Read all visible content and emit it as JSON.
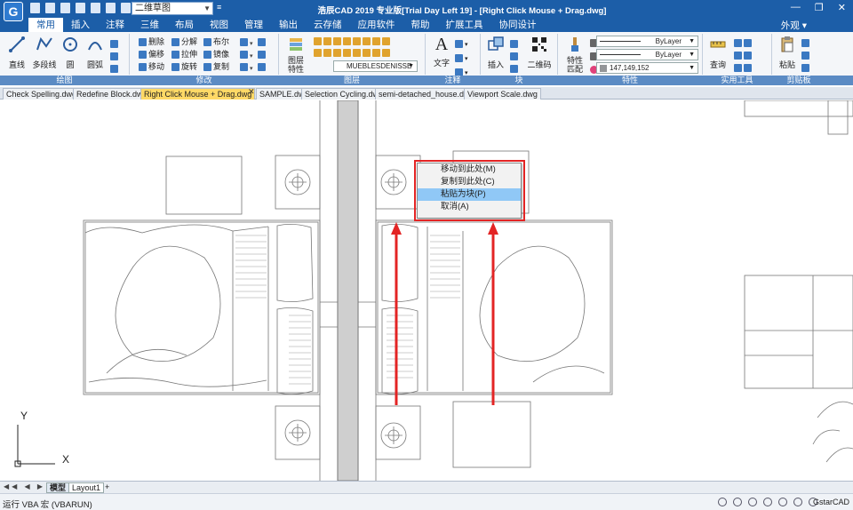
{
  "app": {
    "title": "浩辰CAD 2019 专业版[Trial Day Left 19] - [Right Click Mouse + Drag.dwg]",
    "workspace": "二维草图",
    "window_controls": [
      "—",
      "❐",
      "✕"
    ]
  },
  "menu": {
    "tabs": [
      "常用",
      "插入",
      "注释",
      "三维",
      "布局",
      "视图",
      "管理",
      "输出",
      "云存储",
      "应用软件",
      "帮助",
      "扩展工具",
      "协同设计"
    ],
    "active": "常用",
    "right": "外观 ▾"
  },
  "ribbon": {
    "panels": [
      "绘图",
      "修改",
      "图层",
      "注释",
      "块",
      "特性",
      "实用工具",
      "剪贴板"
    ],
    "draw": {
      "line": "直线",
      "polyline": "多段线",
      "circle": "圆",
      "arc": "圆弧"
    },
    "modify": {
      "erase": "删除",
      "offset": "偏移",
      "move": "移动",
      "explode": "分解",
      "stretch": "拉伸",
      "rotate": "旋转",
      "boolean": "布尔",
      "mirror": "镜像",
      "copy": "复制"
    },
    "layer": {
      "properties": "图层\n特性",
      "current": "MUEBLESDENISSE"
    },
    "annot": {
      "text": "文字"
    },
    "block": {
      "insert": "插入",
      "qrcode": "二维码"
    },
    "props": {
      "match": "特性\n匹配",
      "bylayer1": "ByLayer",
      "bylayer2": "ByLayer",
      "color": "147,149,152"
    },
    "util": {
      "query": "查询"
    },
    "clip": {
      "paste": "粘贴"
    }
  },
  "file_tabs": [
    "Check Spelling.dwg",
    "Redefine Block.dwg",
    "Right Click Mouse + Drag.dwg",
    "SAMPLE.dwg",
    "Selection Cycling.dwg",
    "semi-detached_house.dwg",
    "Viewport Scale.dwg"
  ],
  "active_file": "Right Click Mouse + Drag.dwg",
  "context_menu": {
    "items": [
      "移动到此处(M)",
      "复制到此处(C)",
      "粘贴为块(P)",
      "取消(A)"
    ],
    "highlighted": "粘贴为块(P)"
  },
  "ucs": {
    "x": "X",
    "y": "Y"
  },
  "layout_tabs": [
    "模型",
    "Layout1"
  ],
  "layout_nav": "◀◀ ◀ ▶ ▶▶",
  "status": {
    "text": "运行 VBA 宏 (VBARUN)",
    "brand": "GstarCAD"
  },
  "colors": {
    "titlebar": "#1c5ea8",
    "panelbar": "#5b8bc4",
    "highlight": "#90c8f6",
    "annotation_red": "#e32424",
    "active_tab": "#ffd966"
  }
}
